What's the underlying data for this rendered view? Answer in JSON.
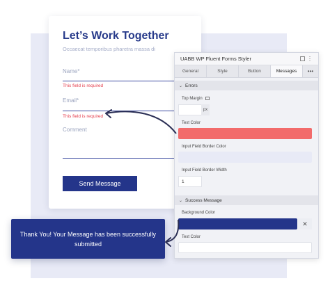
{
  "form": {
    "title": "Let’s Work Together",
    "subtitle": "Occaecat temporibus pharetra massa di",
    "fields": [
      {
        "label": "Name*",
        "error": "This field is required"
      },
      {
        "label": "Email*",
        "error": "This field is required"
      },
      {
        "label": "Comment"
      }
    ],
    "submit_label": "Send Message"
  },
  "panel": {
    "title": "UABB WP Fluent Forms Styler",
    "tabs": [
      "General",
      "Style",
      "Button",
      "Messages"
    ],
    "active_tab": "Messages",
    "more_label": "•••",
    "errors_section": {
      "title": "Errors",
      "top_margin_label": "Top Margin",
      "unit": "px",
      "text_color_label": "Text Color",
      "text_color": "#f26b6b",
      "border_color_label": "Input Field Border Color",
      "border_color": "#e8eaf6",
      "border_width_label": "Input Field Border Width",
      "border_width_value": "1"
    },
    "success_section": {
      "title": "Success Message",
      "bg_color_label": "Background Color",
      "bg_color": "#24358a",
      "clear_label": "✕",
      "text_color_label": "Text Color",
      "text_color": "#ffffff"
    }
  },
  "toast": {
    "message": "Thank You! Your Message has been successfully submitted"
  }
}
